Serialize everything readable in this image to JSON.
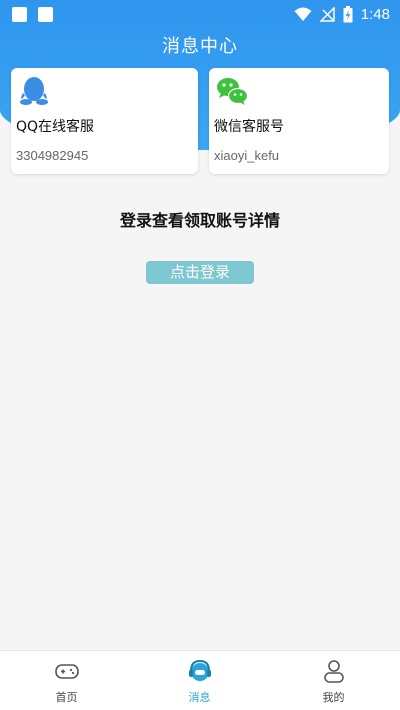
{
  "header": {
    "title": "消息中心"
  },
  "status_bar": {
    "time": "1:48"
  },
  "cards": {
    "qq": {
      "name": "QQ在线客服",
      "account": "3304982945"
    },
    "wechat": {
      "name": "微信客服号",
      "account": "xiaoyi_kefu"
    }
  },
  "main": {
    "prompt": "登录查看领取账号详情",
    "login_button": "点击登录"
  },
  "tabs": [
    {
      "label": "首页",
      "icon": "gamepad-icon"
    },
    {
      "label": "消息",
      "icon": "headset-icon",
      "active": true
    },
    {
      "label": "我的",
      "icon": "user-icon"
    }
  ],
  "colors": {
    "header": "#2f95ee",
    "login_button": "#7cc7d1",
    "active_tab": "#29a5d8",
    "qq_blue": "#3a8ee6",
    "wechat_green": "#3ec23e"
  }
}
